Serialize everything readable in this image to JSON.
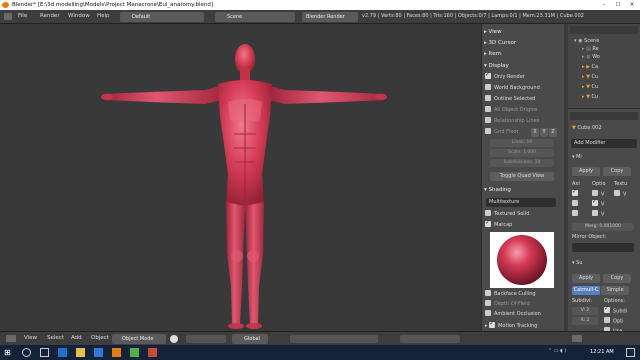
{
  "window": {
    "title": "Blender* [E:\\3d modelling\\Models\\Project Manacrone\\Eul_anatomy.blend]"
  },
  "menu": [
    "File",
    "Render",
    "Window",
    "Help"
  ],
  "layout": "Default",
  "scene": "Scene",
  "engine": "Blender Render",
  "stats": "v2.79 | Verts:80 | Faces:80 | Tris:160 | Objects:0/7 | Lamps:0/1 | Mem:23.31M | Cube.002",
  "npanel": {
    "view": "View",
    "cursor": "3D Cursor",
    "item": "Item",
    "display": "Display",
    "only_render": "Only Render",
    "world_background": "World Background",
    "outline_selected": "Outline Selected",
    "all_object_origins": "All Object Origins",
    "relationship_lines": "Relationship Lines",
    "grid_floor": "Grid Floor",
    "grid_x": "X",
    "grid_y": "Y",
    "grid_z": "Z",
    "lines": "Lines:",
    "lines_val": "16",
    "scale": "Scale:",
    "scale_val": "1.000",
    "subdiv": "Subdivisions:",
    "subdiv_val": "10",
    "toggle_quad": "Toggle Quad View",
    "shading": "Shading",
    "multitexture": "Multitexture",
    "textured_solid": "Textured Solid",
    "matcap": "Matcap",
    "backface": "Backface Culling",
    "dof": "Depth Of Field",
    "ao": "Ambient Occlusion",
    "motion": "Motion Tracking"
  },
  "outliner": {
    "items": [
      "Scene",
      "Re",
      "Wo",
      "Ca",
      "Cu",
      "Cu",
      "Cu"
    ]
  },
  "modifiers": {
    "obj": "Cube.002",
    "add": "Add Modifier",
    "mod1": "Mi",
    "apply": "Apply",
    "copy": "Copy",
    "axis": "Axi",
    "options": "Optio",
    "texture": "Textu",
    "x": "X",
    "y": "Y",
    "z": "Z",
    "v": "V",
    "merge": "Merg: 0.001000",
    "mirror_object": "Mirror Object:",
    "mod2": "Su",
    "catmull": "Catmull-C",
    "simple": "Simple",
    "subdiv": "Subdivi:",
    "options2": "Options:",
    "view": "V: 2",
    "render": "R: 2",
    "subdiv_uv": "Subdi",
    "opt": "Opti",
    "use": "Use"
  },
  "vheader": {
    "view": "View",
    "select": "Select",
    "add": "Add",
    "object": "Object",
    "mode": "Object Mode",
    "orientation": "Global"
  },
  "taskbar": {
    "time": "12:21 AM"
  },
  "colors": {
    "body": "#d63a55",
    "accent": "#5680c2"
  }
}
